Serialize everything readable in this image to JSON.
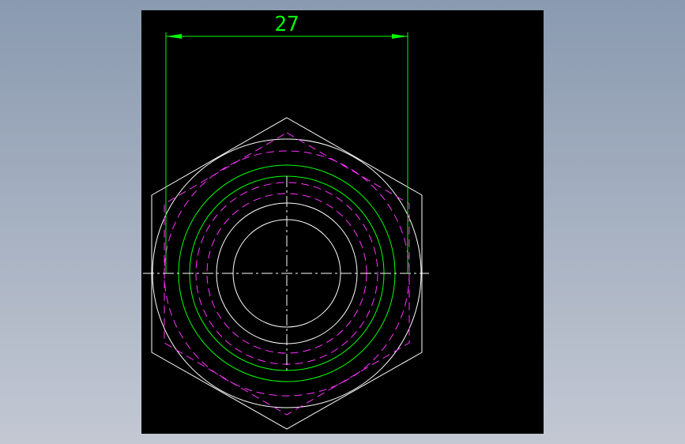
{
  "drawing": {
    "background": "#000000",
    "colors": {
      "outline": "#ffffff",
      "dimension": "#00ff00",
      "hidden": "#ff33ff",
      "centerline": "#ffffff"
    },
    "dimension": {
      "value": "27"
    }
  }
}
